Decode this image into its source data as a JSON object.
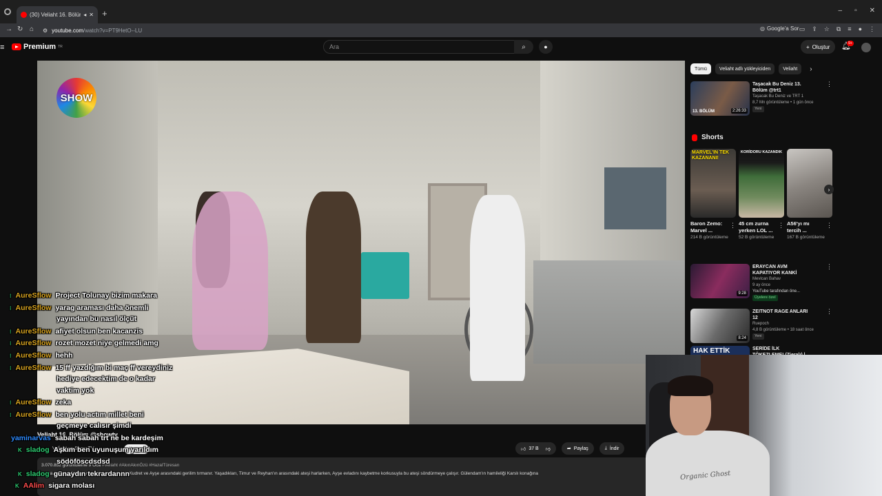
{
  "browser": {
    "tab_title": "(30) Veliaht 16. Bölüm @sh",
    "url_host": "youtube.com",
    "url_path": "/watch?v=PT9HetO--LU",
    "google_ask": "Google'a Sor"
  },
  "header": {
    "logo_text": "Premium",
    "logo_region": "TR",
    "search_placeholder": "Ara",
    "create_label": "Oluştur",
    "notification_count": "9+"
  },
  "video": {
    "channel_logo_text": "SHOW",
    "title": "Veliaht 16. Bölüm @showtv",
    "channel_name": "Veliaht ve Show TV ",
    "subscribe_label": "Abone ol",
    "like_count": "37 B",
    "share_label": "Paylaş",
    "download_label": "İndir",
    "views_date": "3.070.852 görüntüleme  9 Oca",
    "tags": "#Veliaht #AkınAkınÖzü #HazalTüresan",
    "description": "sonra Ayşe ve Gülşah'ı konağa getirmesiyle Kudret ve Ayşe arasındaki gerilim tırmanır. Yaşadıkları, Timur ve Reyhan'ın arasındaki ateşi harlarken, Ayşe evladını kaybetme korkusuyla bu ateşi söndürmeye çalışır. Gülendam'ın hamileliği Karslı konağına"
  },
  "sidebar": {
    "chips": [
      "Tümü",
      "Veliaht adlı yükleyiciden",
      "Veliaht"
    ],
    "rec_top": {
      "title": "Taşacak Bu Deniz 13. Bölüm @trt1",
      "channel": "Taşacak Bu Deniz  ve TRT 1 ",
      "stats": "8,7 Mn görüntüleme • 1 gün önce",
      "badge": "Yeni",
      "duration": "2:26:33",
      "thumb_text": "13. BÖLÜM"
    },
    "shorts_title": "Shorts",
    "shorts": [
      {
        "title": "Baron Zemo: Marvel ...",
        "views": "214 B görüntüleme",
        "overlay": "MARVEL'IN TEK KAZANANI!"
      },
      {
        "title": "45 cm zurna yerken LOL ...",
        "views": "52 B görüntüleme",
        "overlay": "KORİDORU KAZANDIK"
      },
      {
        "title": "A56'yı mı tercih ...",
        "views": "167 B görüntüleme",
        "overlay": ""
      }
    ],
    "recs": [
      {
        "title": "ERAYCAN AVM KAPATIYOR KANKİ",
        "channel": "Mevlcan Bahav ",
        "stats": "9 ay önce",
        "extra": "YouTube tarafından öne...",
        "badge": "Üyelere özel",
        "duration": "9:28"
      },
      {
        "title": "ZEITNOT RAGE ANLARI 12",
        "channel": "Ruepoch",
        "stats": "4,8 B görüntüleme • 18 saat önce",
        "extra": "",
        "badge": "Yeni",
        "duration": "8:24"
      },
      {
        "title": "SERİDE İLK TÖKEZLEME! (Zieralı) | Bölüm 3",
        "channel": "",
        "stats": "",
        "extra": "",
        "badge": "",
        "duration": "",
        "thumb_text": "HAK ETTİK"
      }
    ]
  },
  "chat": [
    {
      "user": "AureSflow",
      "text": "Project Tolunay bizim makara",
      "color": "gold"
    },
    {
      "user": "AureSflow",
      "text": "yarag araması daha önemli",
      "color": "gold"
    },
    {
      "user": "",
      "text": "yayından bu nasıl ölçüt",
      "color": "gold"
    },
    {
      "user": "AureSflow",
      "text": "afiyet olsun ben kacanzis",
      "color": "gold"
    },
    {
      "user": "AureSflow",
      "text": "rozet mozet niye gelmedi amg",
      "color": "gold"
    },
    {
      "user": "AureSflow",
      "text": "hehh",
      "color": "gold"
    },
    {
      "user": "AureSflow",
      "text": "15 ff yazdığım bi maç ff vereydiniz",
      "color": "gold"
    },
    {
      "user": "",
      "text": "hediye edecektim de o kadar",
      "color": "gold"
    },
    {
      "user": "",
      "text": "vaktim yok",
      "color": "gold"
    },
    {
      "user": "AureSflow",
      "text": "zeka",
      "color": "gold"
    },
    {
      "user": "AureSflow",
      "text": "ben yolu actım millet beni",
      "color": "gold"
    },
    {
      "user": "",
      "text": "geçmeye calısır şimdi",
      "color": "gold"
    },
    {
      "user": "yaminarvas",
      "text": "sabah sabah trt ne be kardeşim",
      "color": "blue"
    },
    {
      "user": "sladog",
      "text": "Aşkım ben uyunuşum yarıldım",
      "color": "green"
    },
    {
      "user": "",
      "text": "södöföscdsdsd",
      "color": "green"
    },
    {
      "user": "sladog",
      "text": "günaydın tekrardannn",
      "color": "green"
    },
    {
      "user": "AAlim",
      "text": "sigara molası",
      "color": "red"
    }
  ],
  "webcam": {
    "shirt_text": "Organic Ghost"
  }
}
